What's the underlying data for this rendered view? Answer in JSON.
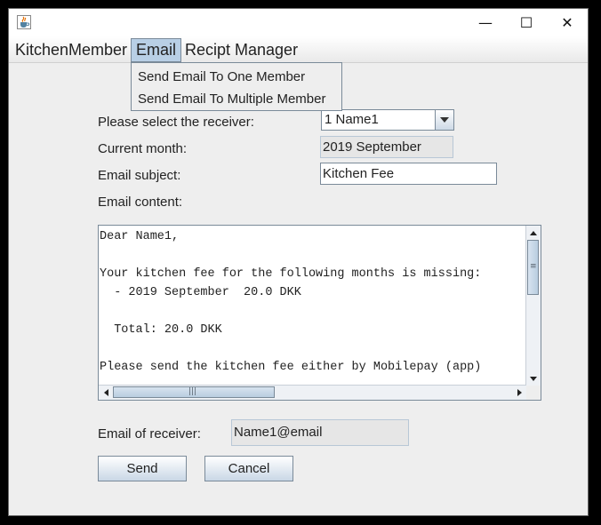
{
  "window": {
    "icon": "java-coffee-cup-icon",
    "minimize": "—",
    "maximize": "☐",
    "close": "✕"
  },
  "menubar": {
    "items": [
      "KitchenMember",
      "Email",
      "Recipt Manager"
    ],
    "active": "Email"
  },
  "email_menu": {
    "items": [
      "Send Email To One Member",
      "Send Email To Multiple Member"
    ]
  },
  "form": {
    "receiver_label": "Please select the receiver:",
    "receiver_value": "1 Name1",
    "month_label": "Current month:",
    "month_value": "2019 September",
    "subject_label": "Email subject:",
    "subject_value": "Kitchen Fee",
    "content_label": "Email content:",
    "content_lines": [
      "Dear Name1,",
      "",
      "Your kitchen fee for the following months is missing:",
      "  - 2019 September  20.0 DKK",
      "",
      "  Total: 20.0 DKK",
      "",
      "Please send the kitchen fee either by Mobilepay (app)"
    ],
    "receiver_email_label": "Email of receiver:",
    "receiver_email_value": "Name1@email"
  },
  "buttons": {
    "send": "Send",
    "cancel": "Cancel"
  },
  "colors": {
    "window_bg": "#eeeeee",
    "menu_highlight": "#b8cfe5",
    "border": "#7a8a99"
  }
}
